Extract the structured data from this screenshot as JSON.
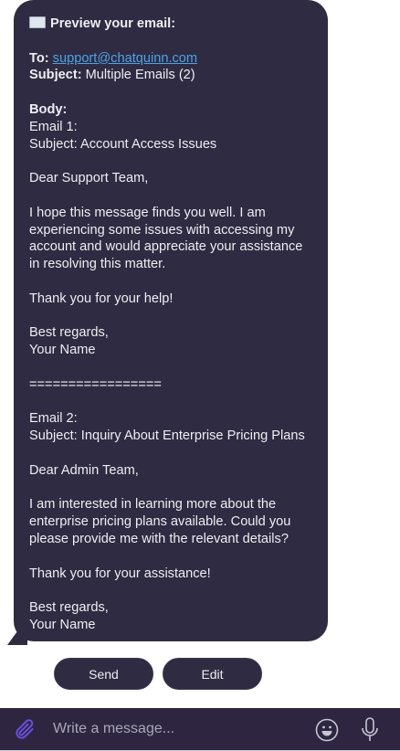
{
  "message": {
    "header_icon": "envelope-icon",
    "header": "Preview your email:",
    "to_label": "To:",
    "to_value": "support@chatquinn.com",
    "subject_label": "Subject:",
    "subject_value": "Multiple Emails (2)",
    "body_label": "Body:",
    "body_lines": [
      "Email 1:",
      "Subject: Account Access Issues",
      "",
      "Dear Support Team,",
      "",
      "I hope this message finds you well. I am",
      "experiencing some issues with accessing my",
      "account and would appreciate your assistance",
      "in resolving this matter.",
      "",
      "Thank you for your help!",
      "",
      "Best regards,",
      "Your Name",
      "",
      "=================",
      "",
      "Email 2:",
      "Subject: Inquiry About Enterprise Pricing Plans",
      "",
      "Dear Admin Team,",
      "",
      "I am interested in learning more about the",
      "enterprise pricing plans available. Could you",
      "please provide me with the relevant details?",
      "",
      "Thank you for your assistance!",
      "",
      "Best regards,",
      "Your Name"
    ]
  },
  "actions": {
    "send": "Send",
    "edit": "Edit"
  },
  "composer": {
    "placeholder": "Write a message...",
    "attach_icon": "paperclip-icon",
    "emoji_icon": "smiley-icon",
    "mic_icon": "microphone-icon",
    "attach_color": "#6a4fe0"
  }
}
